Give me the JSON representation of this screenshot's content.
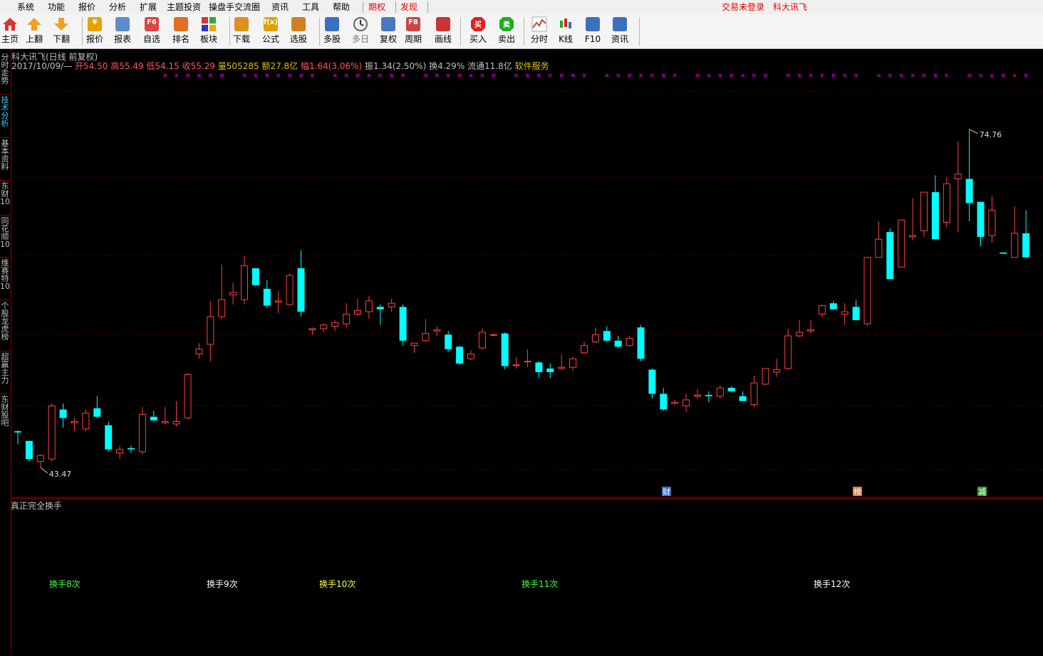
{
  "menu": {
    "items": [
      "系统",
      "功能",
      "报价",
      "分析",
      "扩展",
      "主题投资",
      "操盘手交流圈",
      "资讯",
      "工具",
      "帮助"
    ],
    "special": [
      "期权",
      "发现"
    ],
    "right": [
      "交易未登录",
      "科大讯飞"
    ]
  },
  "toolbar": {
    "buttons": [
      {
        "label": "主页",
        "icon": "home-icon",
        "color": "#d33"
      },
      {
        "label": "上翻",
        "icon": "arrow-up-icon",
        "color": "#f0a020"
      },
      {
        "label": "下翻",
        "icon": "arrow-down-icon",
        "color": "#f0a020"
      },
      {
        "label": "报价",
        "icon": "yen-icon",
        "color": "#e8a000"
      },
      {
        "label": "报表",
        "icon": "report-icon",
        "color": "#5c8ccc"
      },
      {
        "label": "自选",
        "icon": "f6-icon",
        "color": "#d44"
      },
      {
        "label": "排名",
        "icon": "ranking-icon",
        "color": "#e07020"
      },
      {
        "label": "板块",
        "icon": "blocks-icon",
        "color": "#d44"
      },
      {
        "label": "下载",
        "icon": "download-icon",
        "color": "#e09020"
      },
      {
        "label": "公式",
        "icon": "formula-icon",
        "color": "#e0a000"
      },
      {
        "label": "选股",
        "icon": "stock-select-icon",
        "color": "#d08020"
      },
      {
        "label": "多股",
        "icon": "multi-stock-icon",
        "color": "#3a70c0"
      },
      {
        "label": "多日",
        "icon": "clock-icon",
        "color": "#888"
      },
      {
        "label": "复权",
        "icon": "restore-right-icon",
        "color": "#4a78c0"
      },
      {
        "label": "周期",
        "icon": "f8-icon",
        "color": "#c44"
      },
      {
        "label": "画线",
        "icon": "draw-line-icon",
        "color": "#c33"
      },
      {
        "label": "买入",
        "icon": "buy-icon",
        "color": "#d22"
      },
      {
        "label": "卖出",
        "icon": "sell-icon",
        "color": "#2a2"
      },
      {
        "label": "分时",
        "icon": "intraday-icon",
        "color": "#c44"
      },
      {
        "label": "K线",
        "icon": "kline-icon",
        "color": "#3a70c0"
      },
      {
        "label": "F10",
        "icon": "f10-icon",
        "color": "#3a70c0"
      },
      {
        "label": "资讯",
        "icon": "news-icon",
        "color": "#3a70c0"
      }
    ],
    "buy_glyph": "买",
    "sell_glyph": "卖",
    "f6_glyph": "F6",
    "f8_glyph": "F8",
    "yen_glyph": "¥",
    "fx_glyph": "f(x)"
  },
  "left_tabs": [
    {
      "label": "分时走势",
      "active": false
    },
    {
      "label": "技术分析",
      "active": true
    },
    {
      "label": "基本资料",
      "active": false
    },
    {
      "label": "东财10",
      "active": false
    },
    {
      "label": "同花顺10",
      "active": false
    },
    {
      "label": "维赛特10",
      "active": false
    },
    {
      "label": "个股龙虎榜",
      "active": false
    },
    {
      "label": "超赢主力",
      "active": false
    },
    {
      "label": "东财股吧",
      "active": false
    }
  ],
  "chart_header": {
    "title": "科大讯飞(日线 前复权)",
    "date": "2017/10/09/—",
    "open": "开54.50",
    "high": "高55.49",
    "low": "低54.15",
    "close": "收55.29",
    "volume": "量505285",
    "amount": "额27.8亿",
    "change": "幅1.64(3.06%)",
    "amplitude": "振1.34(2.50%)",
    "turnover": "换4.29%",
    "float": "流通11.8亿",
    "service": "软件服务"
  },
  "colors": {
    "up": "#ff4040",
    "down": "#00ffff",
    "marker": "#ff00ff",
    "grid": "#800000",
    "text": "#c0c0c0"
  },
  "chart_data": {
    "type": "candlestick",
    "ylim": [
      42.5,
      76.5
    ],
    "max_label": "74.76",
    "min_label": "43.47",
    "candles": [
      [
        46.5,
        46.6,
        45.4,
        46.4
      ],
      [
        45.7,
        45.7,
        44.0,
        44.2
      ],
      [
        44.0,
        44.6,
        43.5,
        44.5
      ],
      [
        44.2,
        48.8,
        44.0,
        48.6
      ],
      [
        48.3,
        48.8,
        46.8,
        47.6
      ],
      [
        47.2,
        47.6,
        46.5,
        47.3
      ],
      [
        46.7,
        48.3,
        46.5,
        48.0
      ],
      [
        48.4,
        49.4,
        47.6,
        47.7
      ],
      [
        47.0,
        47.3,
        44.8,
        45.0
      ],
      [
        44.7,
        45.3,
        44.2,
        45.0
      ],
      [
        45.1,
        45.3,
        44.7,
        45.0
      ],
      [
        44.8,
        48.5,
        44.6,
        47.9
      ],
      [
        47.7,
        48.2,
        47.3,
        47.4
      ],
      [
        47.2,
        48.5,
        47.1,
        47.3
      ],
      [
        47.1,
        49.0,
        46.9,
        47.3
      ],
      [
        47.6,
        51.3,
        47.5,
        51.2
      ],
      [
        52.9,
        53.8,
        52.5,
        53.3
      ],
      [
        53.7,
        57.3,
        52.3,
        56.0
      ],
      [
        56.0,
        60.3,
        55.8,
        57.4
      ],
      [
        57.8,
        58.8,
        57.0,
        58.0
      ],
      [
        57.4,
        61.0,
        57.0,
        60.2
      ],
      [
        60.0,
        60.0,
        58.5,
        58.6
      ],
      [
        58.3,
        59.0,
        56.7,
        56.9
      ],
      [
        57.2,
        58.1,
        56.3,
        57.3
      ],
      [
        57.0,
        59.6,
        56.9,
        59.4
      ],
      [
        60.0,
        61.5,
        56.0,
        56.4
      ],
      [
        54.9,
        55.1,
        54.5,
        55.0
      ],
      [
        55.0,
        55.4,
        54.7,
        55.3
      ],
      [
        55.2,
        55.7,
        54.8,
        55.5
      ],
      [
        55.4,
        57.1,
        55.1,
        56.2
      ],
      [
        56.2,
        57.5,
        56.1,
        56.5
      ],
      [
        56.4,
        57.7,
        55.8,
        57.3
      ],
      [
        56.8,
        57.0,
        55.3,
        56.6
      ],
      [
        56.8,
        57.5,
        56.4,
        57.1
      ],
      [
        56.8,
        57.0,
        53.6,
        54.0
      ],
      [
        53.6,
        53.8,
        53.0,
        53.8
      ],
      [
        54.0,
        55.8,
        53.9,
        54.6
      ],
      [
        54.8,
        55.2,
        54.4,
        54.9
      ],
      [
        54.5,
        54.8,
        53.1,
        53.3
      ],
      [
        53.5,
        53.6,
        52.0,
        52.1
      ],
      [
        52.5,
        53.2,
        52.4,
        52.9
      ],
      [
        53.4,
        55.0,
        53.3,
        54.7
      ],
      [
        54.5,
        54.6,
        54.4,
        54.5
      ],
      [
        54.6,
        54.7,
        51.6,
        51.9
      ],
      [
        52.0,
        52.6,
        51.7,
        52.0
      ],
      [
        52.3,
        53.3,
        51.8,
        52.3
      ],
      [
        52.2,
        52.3,
        50.9,
        51.4
      ],
      [
        51.7,
        52.1,
        50.9,
        51.4
      ],
      [
        51.7,
        52.9,
        51.6,
        51.8
      ],
      [
        51.8,
        52.7,
        51.5,
        52.5
      ],
      [
        53.0,
        53.9,
        52.9,
        53.6
      ],
      [
        53.9,
        55.1,
        53.8,
        54.5
      ],
      [
        54.8,
        55.2,
        53.9,
        54.0
      ],
      [
        54.0,
        54.4,
        53.4,
        53.5
      ],
      [
        53.6,
        54.4,
        53.5,
        54.2
      ],
      [
        55.1,
        55.3,
        52.3,
        52.5
      ],
      [
        51.6,
        51.7,
        49.2,
        49.6
      ],
      [
        49.6,
        50.1,
        48.2,
        48.3
      ],
      [
        48.8,
        49.1,
        48.7,
        48.9
      ],
      [
        48.6,
        49.6,
        48.1,
        49.1
      ],
      [
        49.4,
        50.0,
        49.2,
        49.5
      ],
      [
        49.5,
        49.8,
        48.9,
        49.4
      ],
      [
        49.4,
        50.3,
        49.2,
        50.1
      ],
      [
        50.1,
        50.2,
        49.7,
        49.8
      ],
      [
        49.4,
        49.8,
        49.0,
        49.0
      ],
      [
        48.7,
        51.1,
        48.5,
        50.5
      ],
      [
        50.4,
        51.7,
        50.3,
        51.7
      ],
      [
        51.4,
        52.5,
        51.0,
        51.6
      ],
      [
        51.7,
        55.0,
        51.6,
        54.4
      ],
      [
        54.4,
        55.7,
        54.3,
        54.7
      ],
      [
        54.8,
        55.7,
        54.6,
        54.9
      ],
      [
        56.2,
        57.0,
        55.9,
        56.9
      ],
      [
        57.1,
        57.3,
        56.8,
        56.6
      ],
      [
        56.2,
        57.1,
        55.3,
        56.4
      ],
      [
        56.8,
        57.4,
        56.1,
        55.7
      ],
      [
        55.4,
        60.9,
        55.2,
        60.9
      ],
      [
        60.9,
        63.9,
        61.0,
        62.4
      ],
      [
        63.0,
        63.3,
        59.7,
        59.1
      ],
      [
        60.1,
        63.2,
        60.6,
        64.0
      ],
      [
        62.6,
        65.8,
        62.3,
        62.7
      ],
      [
        63.1,
        64.4,
        62.6,
        66.3
      ],
      [
        66.3,
        67.7,
        64.2,
        62.4
      ],
      [
        63.8,
        67.5,
        63.4,
        67.0
      ],
      [
        67.4,
        70.5,
        63.0,
        67.8
      ],
      [
        67.4,
        71.5,
        63.9,
        65.4
      ],
      [
        65.5,
        64.0,
        61.8,
        62.6
      ],
      [
        62.7,
        66.0,
        62.1,
        64.8
      ],
      [
        61.3,
        60.0,
        61.6,
        61.2
      ],
      [
        60.9,
        65.1,
        63.1,
        62.9
      ],
      [
        62.9,
        64.8,
        61.6,
        60.9
      ]
    ],
    "lower_pane": {
      "title": "真正完全换手",
      "labels": [
        {
          "text": "换手8次",
          "color": "#40ff40"
        },
        {
          "text": "换手9次",
          "color": "#ffffff"
        },
        {
          "text": "换手10次",
          "color": "#ffff40"
        },
        {
          "text": "换手11次",
          "color": "#40ff40"
        },
        {
          "text": "换手12次",
          "color": "#ffffff"
        }
      ]
    },
    "event_tags": [
      {
        "text": "财",
        "color": "#3a6ed0"
      },
      {
        "text": "榜",
        "color": "#d08040"
      },
      {
        "text": "减",
        "color": "#30a030"
      }
    ],
    "marker_symbol": "×"
  }
}
